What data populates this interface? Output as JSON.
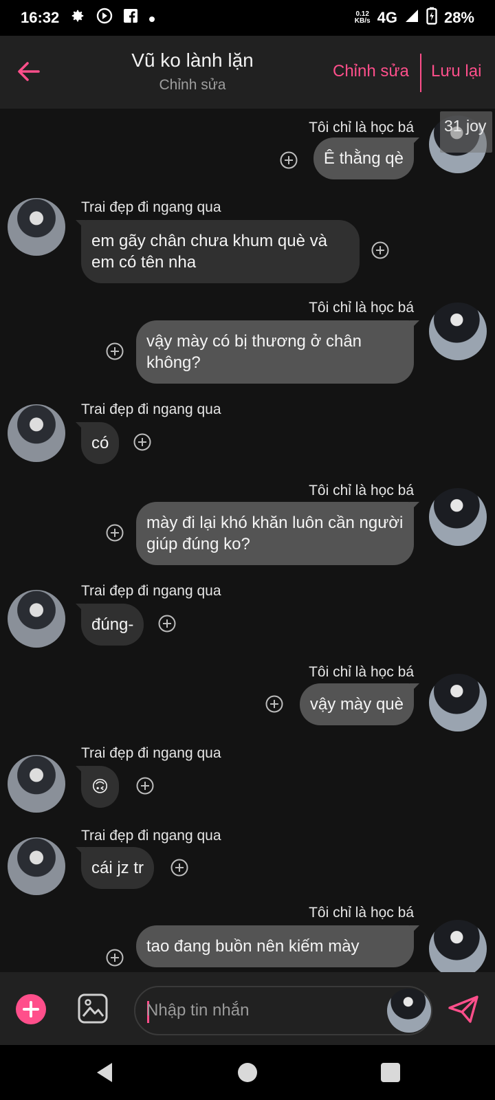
{
  "status_bar": {
    "time": "16:32",
    "speed_value": "0.12",
    "speed_unit": "KB/s",
    "network": "4G",
    "battery": "28%",
    "icons": [
      "settings-icon",
      "no-disturb-icon",
      "facebook-icon",
      "dot-icon",
      "signal-icon",
      "battery-charging-icon"
    ]
  },
  "header": {
    "title": "Vũ ko lành lặn",
    "subtitle": "Chỉnh sửa",
    "edit_label": "Chỉnh sửa",
    "save_label": "Lưu lại",
    "accent_color": "#ff4f8b"
  },
  "corner_badge": "31 joy",
  "messages": [
    {
      "side": "out",
      "sender": "Tôi chỉ là học bá",
      "text": "Ê thằng qè"
    },
    {
      "side": "in",
      "sender": "Trai đẹp đi ngang qua",
      "text": "em gãy chân chưa khum què và em có tên nha"
    },
    {
      "side": "out",
      "sender": "Tôi chỉ là học bá",
      "text": "vậy mày có bị thương ở chân không?"
    },
    {
      "side": "in",
      "sender": "Trai đẹp đi ngang qua",
      "text": "có"
    },
    {
      "side": "out",
      "sender": "Tôi chỉ là học bá",
      "text": "mày đi lại khó khăn luôn cần người giúp đúng ko?"
    },
    {
      "side": "in",
      "sender": "Trai đẹp đi ngang qua",
      "text": "đúng-"
    },
    {
      "side": "out",
      "sender": "Tôi chỉ là học bá",
      "text": "vậy mày què"
    },
    {
      "side": "in",
      "sender": "Trai đẹp đi ngang qua",
      "text": "🙃"
    },
    {
      "side": "in",
      "sender": "Trai đẹp đi ngang qua",
      "text": "cái jz tr"
    },
    {
      "side": "out",
      "sender": "Tôi chỉ là học bá",
      "text": "tao đang buồn nên kiếm mày"
    }
  ],
  "composer": {
    "placeholder": "Nhập tin nhắn"
  },
  "nav": {
    "icons": [
      "back-triangle-icon",
      "home-circle-icon",
      "recents-square-icon"
    ]
  }
}
